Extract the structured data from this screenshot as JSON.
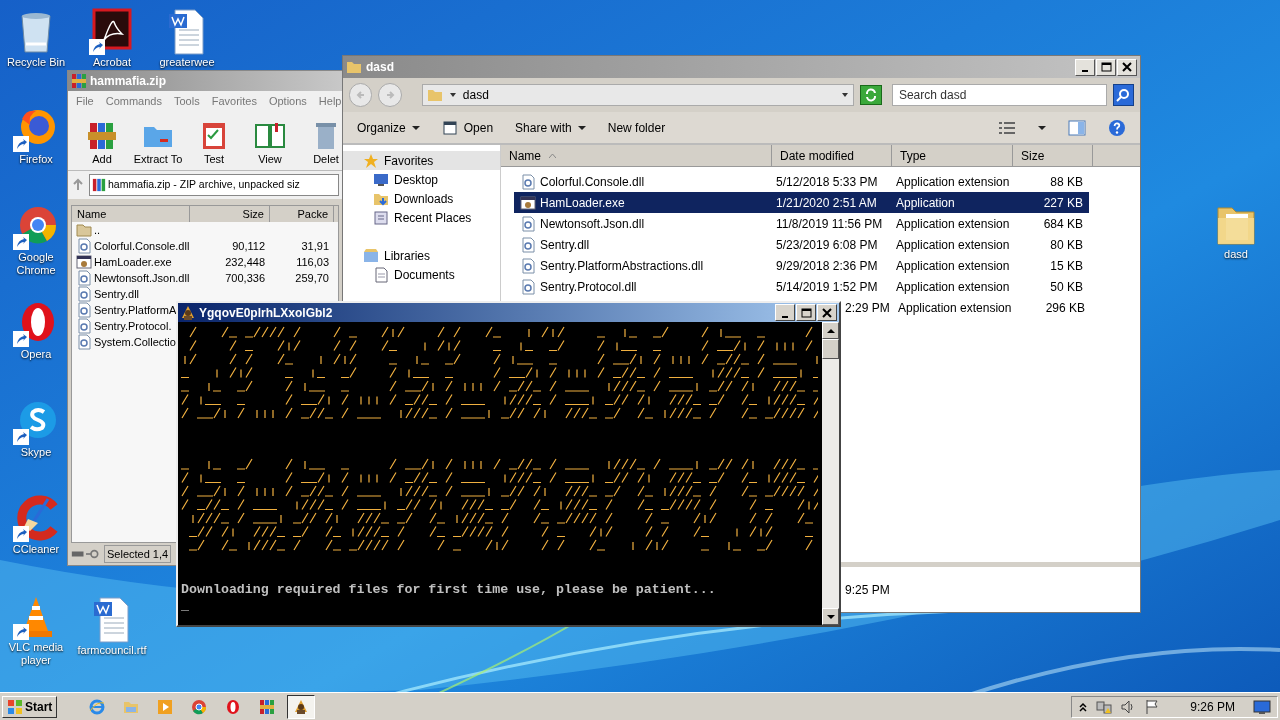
{
  "desktop_icons": [
    {
      "label": "Recycle Bin",
      "kind": "recycle-bin",
      "shortcut": false
    },
    {
      "label": "Acrobat",
      "kind": "acrobat",
      "shortcut": true
    },
    {
      "label": "greaterwee",
      "kind": "word",
      "shortcut": false
    },
    {
      "label": "Firefox",
      "kind": "firefox",
      "shortcut": true
    },
    {
      "label": "Google Chrome",
      "kind": "chrome",
      "shortcut": true
    },
    {
      "label": "Opera",
      "kind": "opera",
      "shortcut": true
    },
    {
      "label": "Skype",
      "kind": "skype",
      "shortcut": true
    },
    {
      "label": "CCleaner",
      "kind": "ccleaner",
      "shortcut": true
    },
    {
      "label": "VLC media player",
      "kind": "vlc",
      "shortcut": true
    },
    {
      "label": "farmcouncil.rtf",
      "kind": "word",
      "shortcut": false
    },
    {
      "label": "dasd",
      "kind": "folder",
      "shortcut": false
    }
  ],
  "winrar": {
    "title": "hammafia.zip",
    "menu": [
      "File",
      "Commands",
      "Tools",
      "Favorites",
      "Options",
      "Help"
    ],
    "toolbar": [
      {
        "label": "Add",
        "kind": "add"
      },
      {
        "label": "Extract To",
        "kind": "extract"
      },
      {
        "label": "Test",
        "kind": "test"
      },
      {
        "label": "View",
        "kind": "view"
      },
      {
        "label": "Delet",
        "kind": "delete"
      }
    ],
    "path": "hammafia.zip - ZIP archive, unpacked siz",
    "columns": [
      "Name",
      "Size",
      "Packe"
    ],
    "rows": [
      {
        "name": "..",
        "kind": "up"
      },
      {
        "name": "Colorful.Console.dll",
        "kind": "dll",
        "size": "90,112",
        "packed": "31,91"
      },
      {
        "name": "HamLoader.exe",
        "kind": "exe",
        "size": "232,448",
        "packed": "116,03"
      },
      {
        "name": "Newtonsoft.Json.dll",
        "kind": "dll",
        "size": "700,336",
        "packed": "259,70"
      },
      {
        "name": "Sentry.dll",
        "kind": "dll"
      },
      {
        "name": "Sentry.PlatformA",
        "kind": "dll"
      },
      {
        "name": "Sentry.Protocol.",
        "kind": "dll"
      },
      {
        "name": "System.Collectio",
        "kind": "dll"
      }
    ],
    "status": "Selected 1,4"
  },
  "explorer": {
    "title": "dasd",
    "address": "dasd",
    "search_placeholder": "Search dasd",
    "toolbar": [
      {
        "label": "Organize",
        "dropdown": true
      },
      {
        "label": "Open",
        "dropdown": false
      },
      {
        "label": "Share with",
        "dropdown": true
      },
      {
        "label": "New folder",
        "dropdown": false
      }
    ],
    "nav": [
      {
        "label": "Favorites",
        "kind": "favorites",
        "selected": true
      },
      {
        "label": "Desktop",
        "kind": "desktop",
        "selected": false
      },
      {
        "label": "Downloads",
        "kind": "downloads",
        "selected": false
      },
      {
        "label": "Recent Places",
        "kind": "recent",
        "selected": false
      },
      {
        "label": "Libraries",
        "kind": "libraries",
        "selected": false
      },
      {
        "label": "Documents",
        "kind": "documents",
        "selected": false
      }
    ],
    "columns": [
      "Name",
      "Date modified",
      "Type",
      "Size"
    ],
    "rows": [
      {
        "name": "Colorful.Console.dll",
        "kind": "dll",
        "date": "5/12/2018 5:33 PM",
        "type": "Application extension",
        "size": "88 KB",
        "selected": false
      },
      {
        "name": "HamLoader.exe",
        "kind": "exe",
        "date": "1/21/2020 2:51 AM",
        "type": "Application",
        "size": "227 KB",
        "selected": true
      },
      {
        "name": "Newtonsoft.Json.dll",
        "kind": "dll",
        "date": "11/8/2019 11:56 PM",
        "type": "Application extension",
        "size": "684 KB",
        "selected": false
      },
      {
        "name": "Sentry.dll",
        "kind": "dll",
        "date": "5/23/2019 6:08 PM",
        "type": "Application extension",
        "size": "80 KB",
        "selected": false
      },
      {
        "name": "Sentry.PlatformAbstractions.dll",
        "kind": "dll",
        "date": "9/29/2018 2:36 PM",
        "type": "Application extension",
        "size": "15 KB",
        "selected": false
      },
      {
        "name": "Sentry.Protocol.dll",
        "kind": "dll",
        "date": "5/14/2019 1:52 PM",
        "type": "Application extension",
        "size": "50 KB",
        "selected": false
      },
      {
        "date": "2:29 PM",
        "type": "Application extension",
        "size": "296 KB",
        "selected": false
      }
    ],
    "details": "9:25 PM"
  },
  "console": {
    "title": "YgqovE0plrhLXxolGbl2",
    "lines": [
      "Downloading required files for first time use, please be patient..."
    ],
    "cursor": "_"
  },
  "taskbar": {
    "start": "Start",
    "items": [
      {
        "kind": "ie",
        "active": false
      },
      {
        "kind": "explorer",
        "active": false
      },
      {
        "kind": "media",
        "active": false
      },
      {
        "kind": "chrome",
        "active": false
      },
      {
        "kind": "opera",
        "active": false
      },
      {
        "kind": "winrar",
        "active": false
      },
      {
        "kind": "hamloader",
        "active": true
      }
    ],
    "time": "9:26 PM"
  }
}
